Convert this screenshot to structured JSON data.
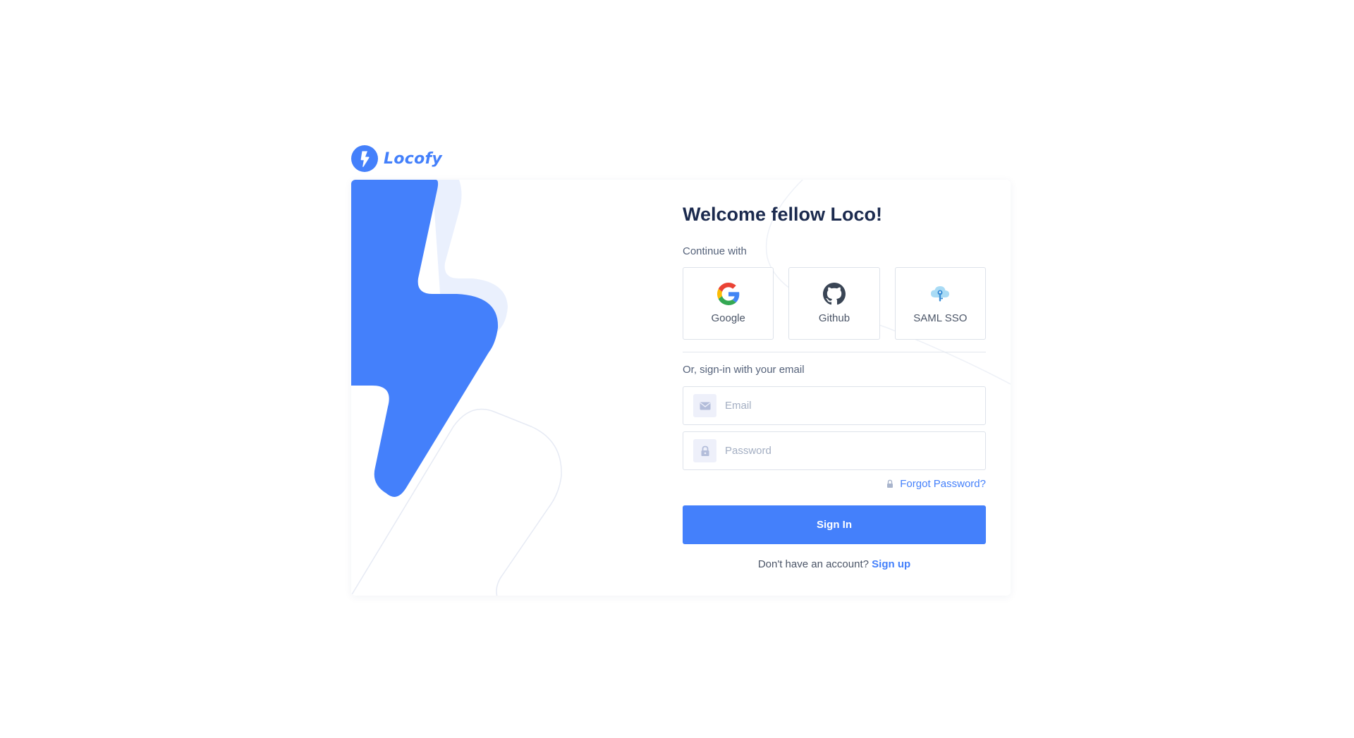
{
  "brand": {
    "name": "Locofy",
    "color": "#4480fb"
  },
  "login": {
    "title": "Welcome fellow Loco!",
    "continue_label": "Continue with",
    "providers": [
      {
        "label": "Google",
        "icon": "google-icon"
      },
      {
        "label": "Github",
        "icon": "github-icon"
      },
      {
        "label": "SAML SSO",
        "icon": "saml-sso-icon"
      }
    ],
    "email_section_label": "Or, sign-in with your email",
    "email": {
      "placeholder": "Email",
      "value": ""
    },
    "password": {
      "placeholder": "Password",
      "value": ""
    },
    "forgot_password": "Forgot Password?",
    "sign_in_label": "Sign In",
    "no_account_text": "Don't have an account?",
    "sign_up_label": "Sign up"
  },
  "colors": {
    "primary": "#4480fb",
    "heading": "#1b2a4e",
    "muted_text": "#55627a",
    "border": "#dde2ea",
    "icon_bg": "#eef0fa"
  }
}
